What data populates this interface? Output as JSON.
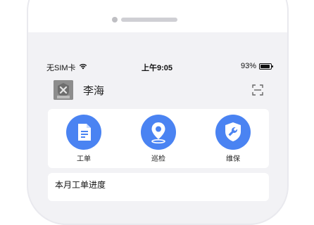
{
  "status_bar": {
    "carrier": "无SIM卡",
    "time": "上午9:05",
    "battery": "93%",
    "battery_level": 0.93
  },
  "header": {
    "username": "李海"
  },
  "quick_actions": [
    {
      "label": "工单",
      "icon": "document-icon"
    },
    {
      "label": "巡检",
      "icon": "location-pin-icon"
    },
    {
      "label": "维保",
      "icon": "wrench-shield-icon"
    }
  ],
  "progress_section": {
    "title": "本月工单进度"
  },
  "colors": {
    "accent": "#4a83f2",
    "background": "#f2f2f5"
  }
}
